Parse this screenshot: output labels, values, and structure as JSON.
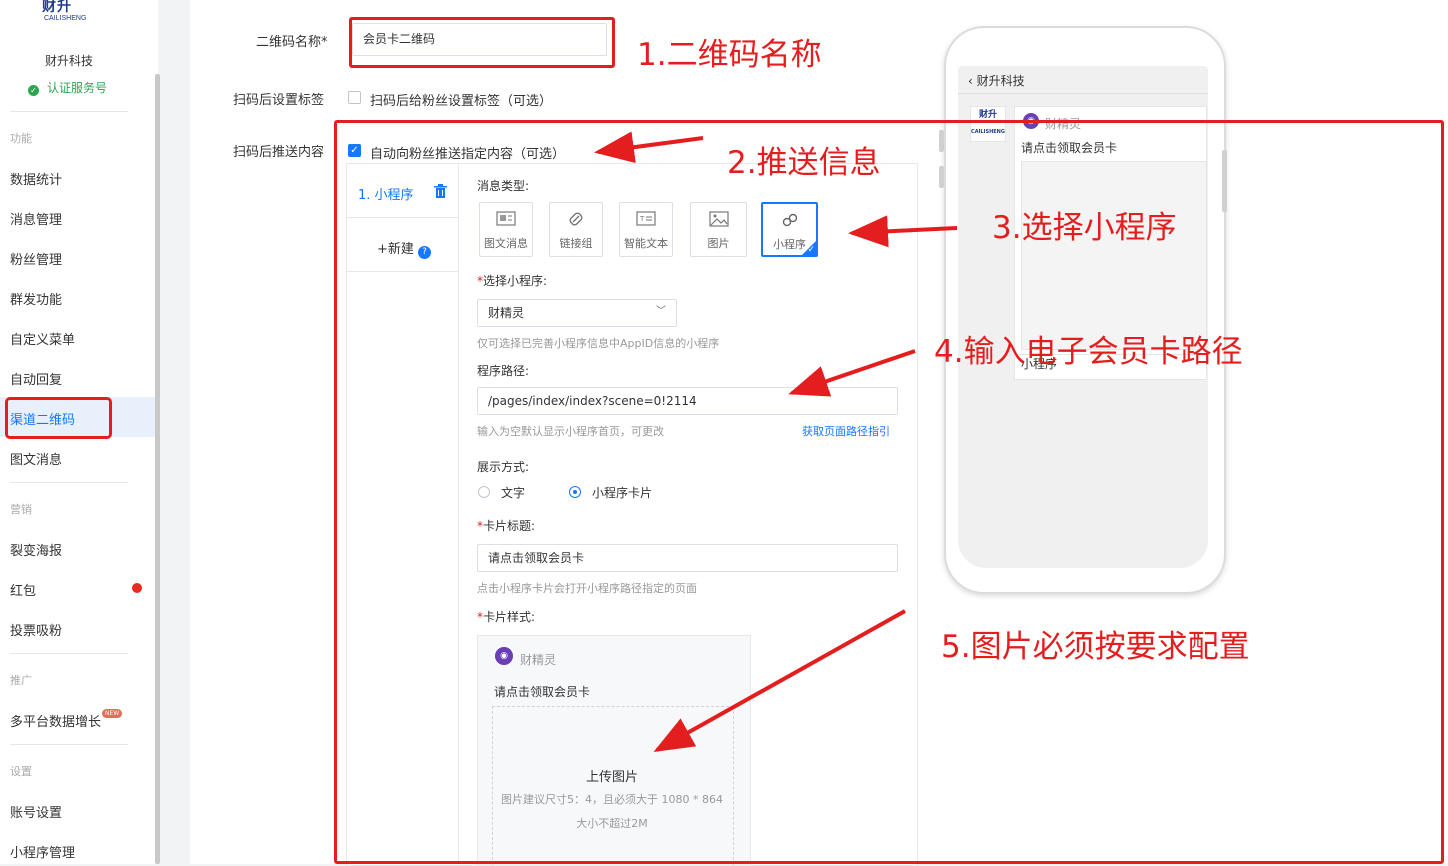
{
  "sidebar": {
    "logo_text": "CAILISHENG",
    "account_name": "财升科技",
    "cert_label": "认证服务号",
    "sections": {
      "function": "功能",
      "marketing": "营销",
      "promo": "推广",
      "settings": "设置"
    },
    "items": {
      "data_stats": "数据统计",
      "message_mgmt": "消息管理",
      "fan_mgmt": "粉丝管理",
      "mass_send": "群发功能",
      "custom_menu": "自定义菜单",
      "auto_reply": "自动回复",
      "channel_qr": "渠道二维码",
      "article_msg": "图文消息",
      "fission_poster": "裂变海报",
      "red_packet": "红包",
      "vote_fans": "投票吸粉",
      "multi_platform": "多平台数据增长",
      "account_settings": "账号设置",
      "miniprogram_mgmt": "小程序管理"
    },
    "new_badge": "NEW"
  },
  "form": {
    "qr_name_label": "二维码名称*",
    "qr_name_value": "会员卡二维码",
    "tag_label": "扫码后设置标签",
    "tag_checkbox": "扫码后给粉丝设置标签（可选）",
    "push_label": "扫码后推送内容",
    "push_checkbox": "自动向粉丝推送指定内容（可选）"
  },
  "editor": {
    "item_label": "1.  小程序",
    "new_label": "+新建",
    "msg_type_label": "消息类型:",
    "types": [
      "图文消息",
      "链接组",
      "智能文本",
      "图片",
      "小程序"
    ],
    "select_mp_label": "选择小程序:",
    "select_mp_value": "财精灵",
    "select_mp_hint": "仅可选择已完善小程序信息中AppID信息的小程序",
    "path_label": "程序路径:",
    "path_value": "/pages/index/index?scene=0!2114",
    "path_hint": "输入为空默认显示小程序首页，可更改",
    "path_link": "获取页面路径指引",
    "display_label": "展示方式:",
    "display_text": "文字",
    "display_card": "小程序卡片",
    "card_title_label": "卡片标题:",
    "card_title_value": "请点击领取会员卡",
    "card_title_hint": "点击小程序卡片会打开小程序路径指定的页面",
    "card_style_label": "卡片样式:",
    "card_mp_name": "财精灵",
    "card_title_preview": "请点击领取会员卡",
    "upload_label": "上传图片",
    "upload_hint1": "图片建议尺寸5：4，且必须大于 1080 * 864",
    "upload_hint2": "大小不超过2M"
  },
  "phone": {
    "title": "财升科技",
    "mp_name": "财精灵",
    "card_title": "请点击领取会员卡",
    "footer": "小程序"
  },
  "annotations": {
    "a1": "1.二维码名称",
    "a2": "2.推送信息",
    "a3": "3.选择小程序",
    "a4": "4.输入电子会员卡路径",
    "a5": "5.图片必须按要求配置"
  }
}
